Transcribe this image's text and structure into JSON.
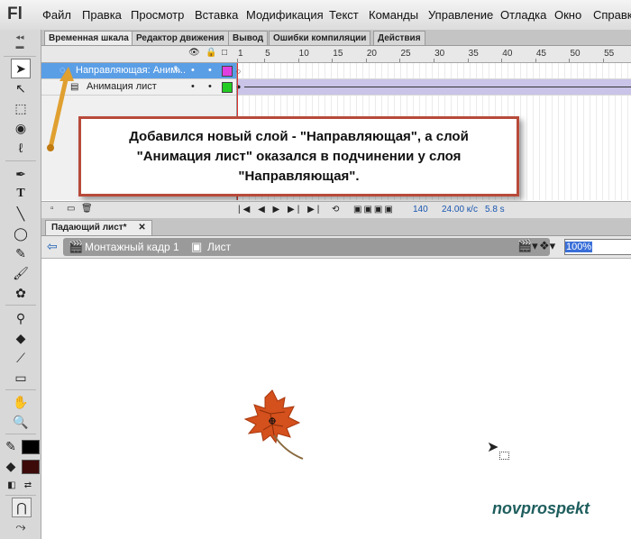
{
  "app": {
    "logo": "Fl"
  },
  "menu": [
    "Файл",
    "Правка",
    "Просмотр",
    "Вставка",
    "Модификация",
    "Текст",
    "Команды",
    "Управление",
    "Отладка",
    "Окно",
    "Справка"
  ],
  "panel_tabs": [
    "Временная шкала",
    "Редактор движения",
    "Вывод",
    "Ошибки компиляции",
    "Действия"
  ],
  "timeline": {
    "ruler": [
      "1",
      "5",
      "10",
      "15",
      "20",
      "25",
      "30",
      "35",
      "40",
      "45",
      "50",
      "55"
    ],
    "layers": [
      {
        "name": "Направляющая: Аним...",
        "selected": true,
        "color": "#e040e0"
      },
      {
        "name": "Анимация лист",
        "selected": false,
        "color": "#22cc22"
      }
    ],
    "frame_number": "140",
    "fps": "24.00 к/с",
    "time": "5.8 s"
  },
  "callout": {
    "line1": "Добавился новый слой - \"Направляющая\", а слой",
    "line2": "\"Анимация лист\" оказался в подчинении у слоя",
    "line3": "\"Направляющая\"."
  },
  "document": {
    "tab": "Падающий лист*",
    "crumb_scene": "Монтажный кадр 1",
    "crumb_symbol": "Лист",
    "zoom": "100%"
  },
  "tools": {
    "stroke_color": "#000000",
    "fill_color": "#3d0a0a"
  },
  "watermark": "novprospekt"
}
